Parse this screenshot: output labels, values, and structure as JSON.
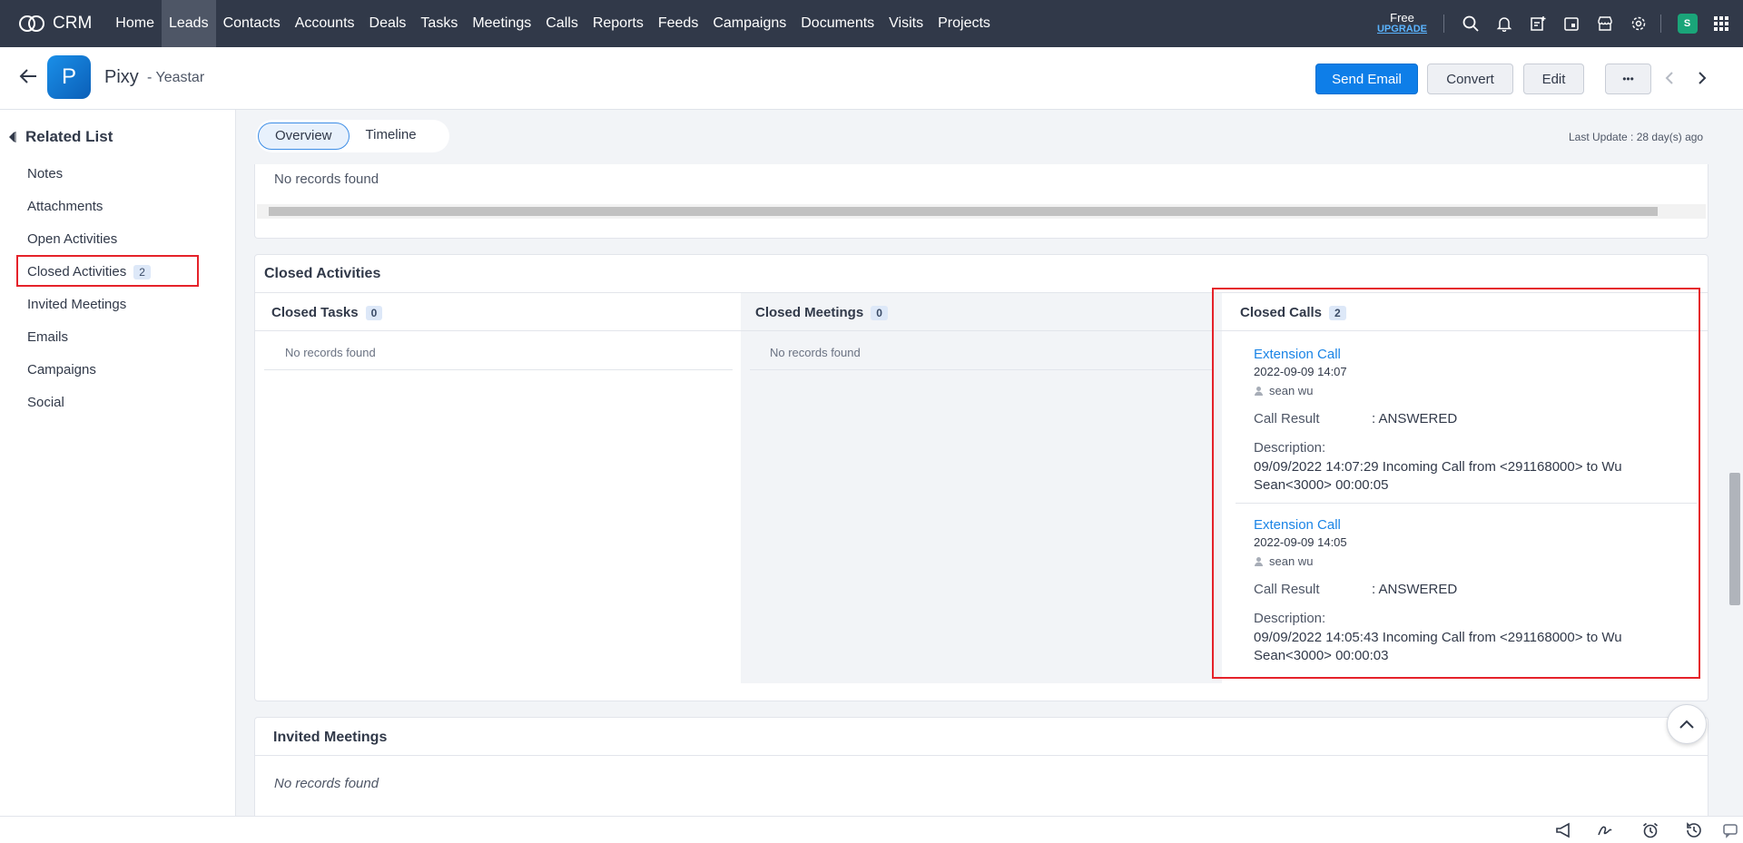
{
  "app": {
    "name": "CRM"
  },
  "nav": {
    "items": [
      "Home",
      "Leads",
      "Contacts",
      "Accounts",
      "Deals",
      "Tasks",
      "Meetings",
      "Calls",
      "Reports",
      "Feeds",
      "Campaigns",
      "Documents",
      "Visits",
      "Projects"
    ],
    "active": "Leads"
  },
  "plan": {
    "label": "Free",
    "upgrade": "UPGRADE"
  },
  "user": {
    "initial": "S"
  },
  "record": {
    "avatar_initial": "P",
    "name": "Pixy",
    "subtitle": "- Yeastar"
  },
  "actions": {
    "send_email": "Send Email",
    "convert": "Convert",
    "edit": "Edit",
    "more": "•••"
  },
  "sidebar": {
    "title": "Related List",
    "items": [
      {
        "label": "Notes"
      },
      {
        "label": "Attachments"
      },
      {
        "label": "Open Activities"
      },
      {
        "label": "Closed Activities",
        "count": "2"
      },
      {
        "label": "Invited Meetings"
      },
      {
        "label": "Emails"
      },
      {
        "label": "Campaigns"
      },
      {
        "label": "Social"
      }
    ]
  },
  "tabs": {
    "overview": "Overview",
    "timeline": "Timeline",
    "active": "Overview"
  },
  "last_update": "Last Update : 28 day(s) ago",
  "top_section": {
    "empty": "No records found"
  },
  "closed_activities": {
    "title": "Closed Activities",
    "tasks": {
      "label": "Closed Tasks",
      "count": "0",
      "empty": "No records found"
    },
    "meetings": {
      "label": "Closed Meetings",
      "count": "0",
      "empty": "No records found"
    },
    "calls": {
      "label": "Closed Calls",
      "count": "2",
      "items": [
        {
          "title": "Extension Call",
          "datetime": "2022-09-09 14:07",
          "owner": "sean wu",
          "result_label": "Call Result",
          "result_value": ": ANSWERED",
          "desc_label": "Description:",
          "desc_line1": "09/09/2022 14:07:29 Incoming Call from <291168000> to Wu",
          "desc_line2": "Sean<3000> 00:00:05"
        },
        {
          "title": "Extension Call",
          "datetime": "2022-09-09 14:05",
          "owner": "sean wu",
          "result_label": "Call Result",
          "result_value": ": ANSWERED",
          "desc_label": "Description:",
          "desc_line1": "09/09/2022 14:05:43 Incoming Call from <291168000> to Wu",
          "desc_line2": "Sean<3000> 00:00:03"
        }
      ]
    }
  },
  "invited_meetings": {
    "title": "Invited Meetings",
    "empty": "No records found"
  },
  "colors": {
    "accent": "#0e7ee8",
    "topbar": "#313949",
    "highlight": "#e5222a",
    "link": "#1a84e6"
  },
  "icons": [
    "crm-logo-icon",
    "search-icon",
    "bell-icon",
    "add-note-icon",
    "calendar-icon",
    "store-icon",
    "gear-icon",
    "apps-grid-icon",
    "back-arrow-icon",
    "prev-record-icon",
    "next-record-icon",
    "collapse-icon",
    "user-icon",
    "chevron-up-icon",
    "megaphone-icon",
    "signature-icon",
    "alarm-icon",
    "history-icon",
    "chat-icon"
  ]
}
